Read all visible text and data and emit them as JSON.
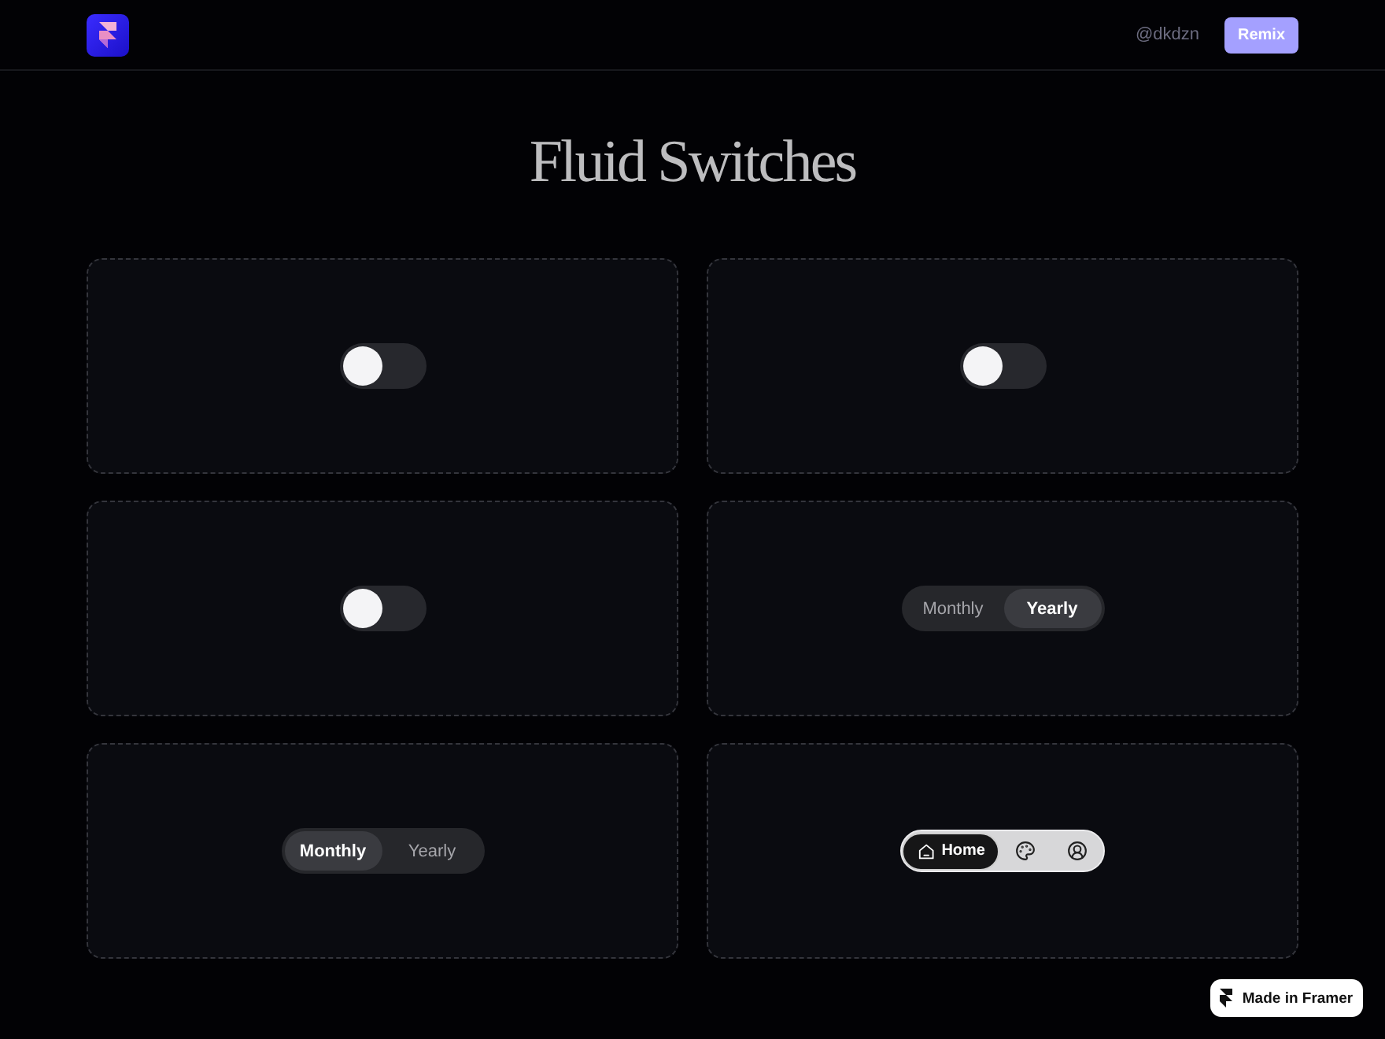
{
  "header": {
    "handle": "@dkdzn",
    "button": "Remix"
  },
  "title": "Fluid Switches",
  "cards": [
    {
      "kind": "toggle",
      "on": false
    },
    {
      "kind": "toggle",
      "on": false
    },
    {
      "kind": "toggle",
      "on": false
    },
    {
      "kind": "segmented",
      "options": [
        {
          "label": "Monthly",
          "selected": false
        },
        {
          "label": "Yearly",
          "selected": true
        }
      ]
    },
    {
      "kind": "segmented",
      "options": [
        {
          "label": "Monthly",
          "selected": true
        },
        {
          "label": "Yearly",
          "selected": false
        }
      ]
    },
    {
      "kind": "tabbar",
      "items": [
        {
          "label": "Home",
          "selected": true
        },
        {
          "selected": false
        },
        {
          "selected": false
        }
      ]
    }
  ],
  "badge": {
    "label": "Made in Framer"
  }
}
